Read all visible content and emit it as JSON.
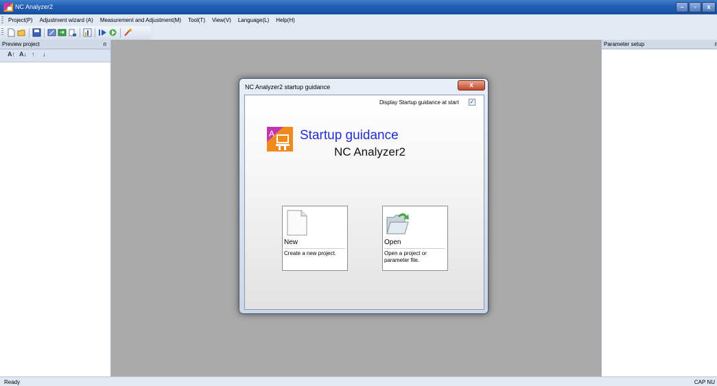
{
  "window": {
    "title": "NC Analyzer2",
    "controls": {
      "minimize": "–",
      "maximize": "▫",
      "close": "x"
    }
  },
  "menubar": {
    "items": [
      "Project(P)",
      "Adjustment wizard (A)",
      "Measurement and Adjustment(M)",
      "Tool(T)",
      "View(V)",
      "Language(L)",
      "Help(H)"
    ]
  },
  "toolbar": {
    "buttons": [
      "new-icon",
      "open-folder-icon",
      "save-icon",
      "settings-icon",
      "export-icon",
      "import-icon",
      "graph-icon",
      "play-icon",
      "connect-icon",
      "tool-icon"
    ]
  },
  "left_panel": {
    "title": "Preview project",
    "pin": "ᴨ",
    "sort_buttons": [
      "A↑",
      "A↓",
      "↑",
      "↓"
    ]
  },
  "right_panel": {
    "title": "Parameter setup",
    "pin": "ᴨ"
  },
  "status": {
    "text": "Ready",
    "indicators": "CAP  NU"
  },
  "dialog": {
    "title": "NC Analyzer2 startup guidance",
    "close": "x",
    "display_at_start_label": "Display Startup guidance at start",
    "display_at_start_checked": "✓",
    "heading": "Startup guidance",
    "subheading": "NC Analyzer2",
    "cards": {
      "new": {
        "label": "New",
        "description": "Create a new project."
      },
      "open": {
        "label": "Open",
        "description": "Open a project or parameter file."
      }
    }
  },
  "colors": {
    "title_bar": "#1f5eb4",
    "heading_blue": "#1f2fd4",
    "center_bg": "#aaaaaa",
    "close_red": "#c44627"
  }
}
